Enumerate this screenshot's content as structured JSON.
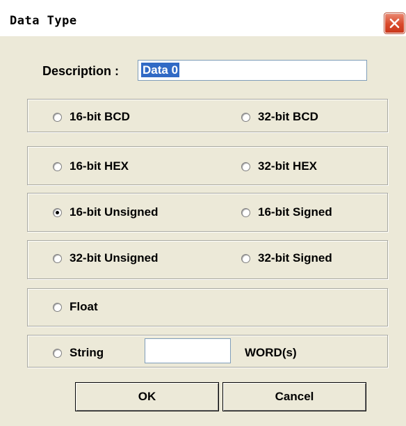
{
  "window": {
    "title": "Data Type"
  },
  "description": {
    "label": "Description :",
    "value": "Data 0"
  },
  "options": {
    "bcd16": {
      "label": "16-bit BCD",
      "checked": false
    },
    "bcd32": {
      "label": "32-bit BCD",
      "checked": false
    },
    "hex16": {
      "label": "16-bit HEX",
      "checked": false
    },
    "hex32": {
      "label": "32-bit HEX",
      "checked": false
    },
    "unsigned16": {
      "label": "16-bit Unsigned",
      "checked": true
    },
    "signed16": {
      "label": "16-bit Signed",
      "checked": false
    },
    "unsigned32": {
      "label": "32-bit Unsigned",
      "checked": false
    },
    "signed32": {
      "label": "32-bit Signed",
      "checked": false
    },
    "float": {
      "label": "Float",
      "checked": false
    },
    "string": {
      "label": "String",
      "checked": false
    }
  },
  "string_words": {
    "value": "",
    "unit_label": "WORD(s)"
  },
  "buttons": {
    "ok": "OK",
    "cancel": "Cancel"
  },
  "colors": {
    "dialog_face": "#ece9d8",
    "selection": "#316ac5",
    "close_button": "#d9492b"
  }
}
